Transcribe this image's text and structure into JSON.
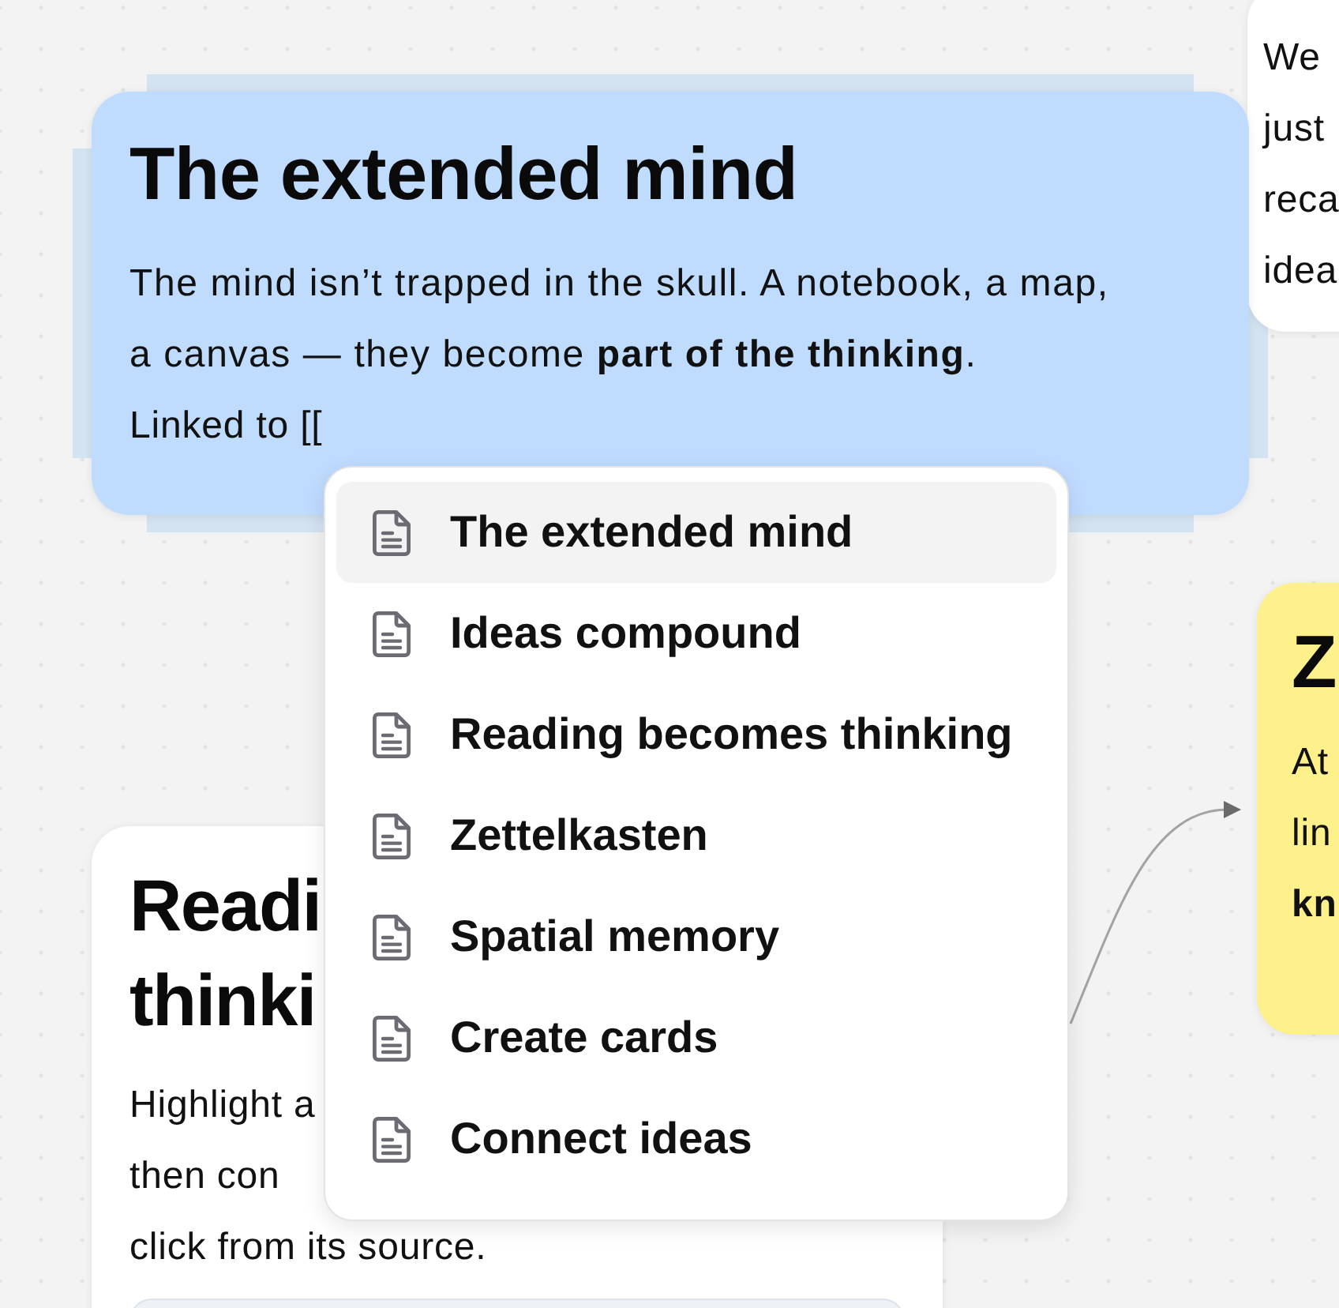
{
  "cards": [
    {
      "color": "#ffffff",
      "selected": false,
      "lines": [
        {
          "text": "We",
          "bold": false
        },
        {
          "text": "just",
          "bold": false
        },
        {
          "text": "reca",
          "bold": false
        },
        {
          "text": "idea",
          "bold": false
        }
      ]
    },
    {
      "color": "#bfdbfe",
      "selected": true,
      "title": "The extended mind",
      "body": "The mind isn’t trapped in the skull. A notebook, a map, a canvas — they become **part of the thinking**.",
      "editing_line": "Linked to [["
    },
    {
      "color": "#fef08a",
      "selected": false,
      "title": "Z",
      "lines": [
        {
          "text": "At",
          "bold": false
        },
        {
          "text": "lin",
          "bold": false
        },
        {
          "text": "kn",
          "bold": true
        }
      ]
    },
    {
      "color": "#ffffff",
      "selected": false,
      "title": "Readi thinki",
      "lines": [
        {
          "text": "Highlight a",
          "bold": false
        },
        {
          "text": "then con",
          "bold": false
        },
        {
          "text": "click from its source.",
          "bold": false
        }
      ],
      "excerpt_box": true
    }
  ],
  "connectors": [
    {
      "kind": "arrow"
    }
  ],
  "link_menu": {
    "items": [
      {
        "label": "The extended mind",
        "selected": true
      },
      {
        "label": "Ideas compound",
        "selected": false
      },
      {
        "label": "Reading becomes thinking",
        "selected": false
      },
      {
        "label": "Zettelkasten",
        "selected": false
      },
      {
        "label": "Spatial memory",
        "selected": false
      },
      {
        "label": "Create cards",
        "selected": false
      },
      {
        "label": "Connect ideas",
        "selected": false
      }
    ]
  }
}
